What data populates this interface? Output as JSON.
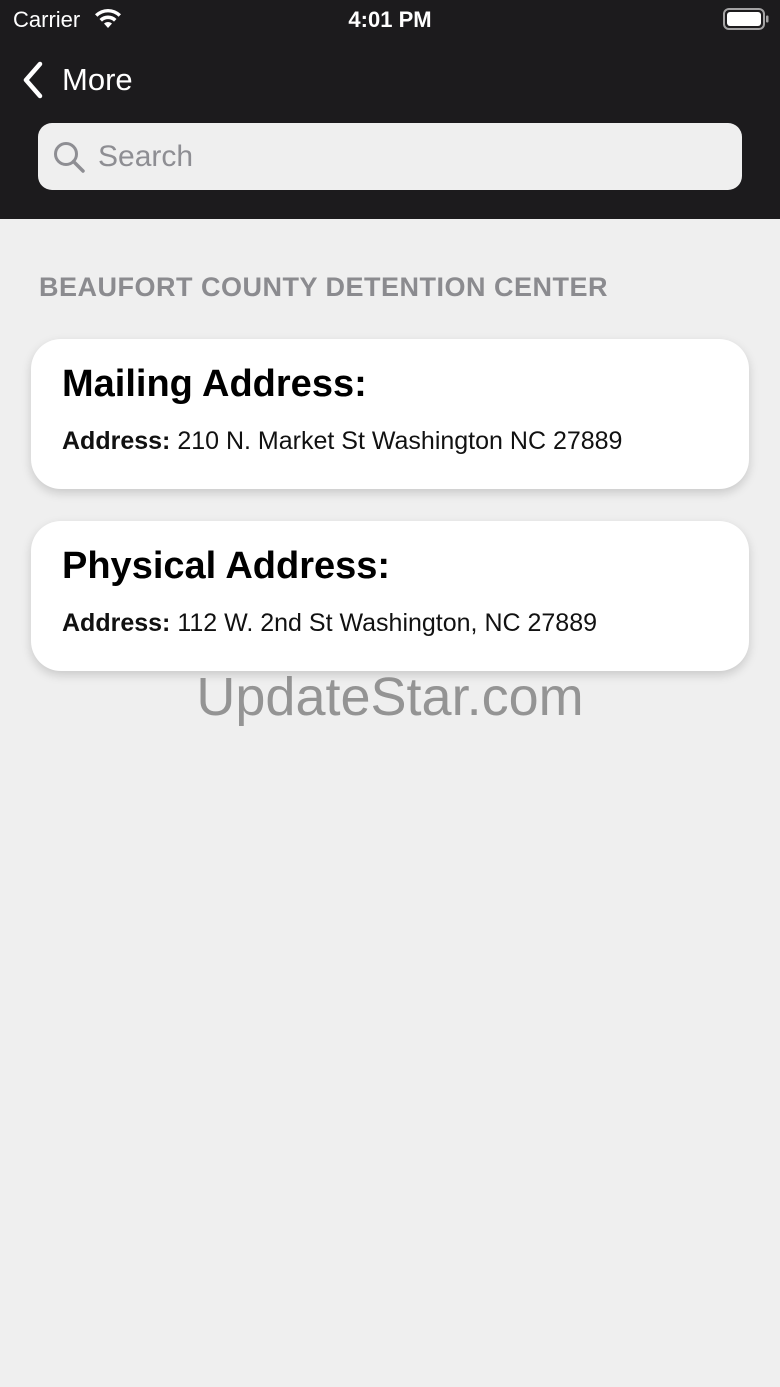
{
  "status_bar": {
    "carrier": "Carrier",
    "time": "4:01 PM"
  },
  "nav": {
    "back_label": "More"
  },
  "search": {
    "placeholder": "Search",
    "value": ""
  },
  "section": {
    "title": "BEAUFORT COUNTY DETENTION CENTER"
  },
  "cards": [
    {
      "title": "Mailing Address:",
      "field_label": "Address:",
      "field_value": "210 N. Market St Washington NC 27889"
    },
    {
      "title": "Physical Address:",
      "field_label": "Address:",
      "field_value": "112 W. 2nd St Washington, NC 27889"
    }
  ],
  "watermark": "UpdateStar.com",
  "colors": {
    "header_bg": "#1c1b1d",
    "page_bg": "#efefef",
    "card_bg": "#ffffff",
    "section_title": "#8b8b8f"
  },
  "icons": [
    "wifi-icon",
    "battery-icon",
    "chevron-left-icon",
    "search-icon"
  ]
}
